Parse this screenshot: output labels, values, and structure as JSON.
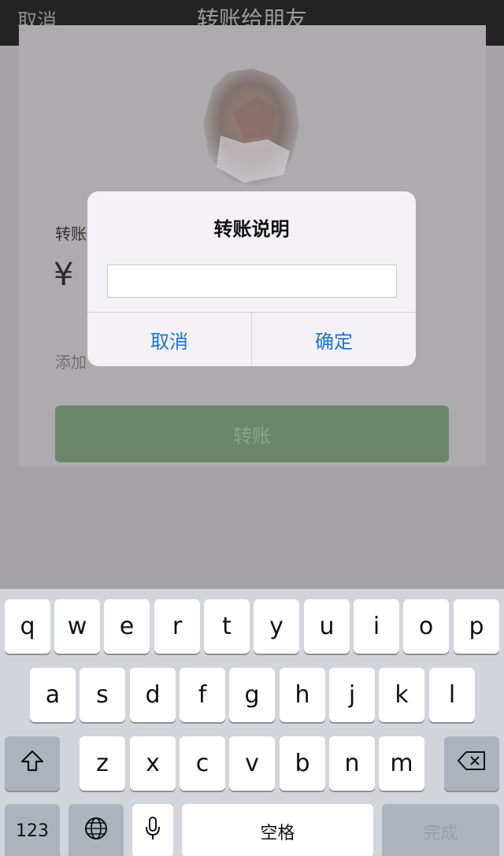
{
  "navbar": {
    "cancel_label": "取消",
    "title": "转账给朋友"
  },
  "page": {
    "amount_label": "转账",
    "currency_symbol": "¥",
    "add_note_label": "添加",
    "transfer_button": "转账"
  },
  "dialog": {
    "title": "转账说明",
    "input_value": "",
    "cancel_label": "取消",
    "confirm_label": "确定"
  },
  "keyboard": {
    "row1": [
      "q",
      "w",
      "e",
      "r",
      "t",
      "y",
      "u",
      "i",
      "o",
      "p"
    ],
    "row2": [
      "a",
      "s",
      "d",
      "f",
      "g",
      "h",
      "j",
      "k",
      "l"
    ],
    "row3": [
      "z",
      "x",
      "c",
      "v",
      "b",
      "n",
      "m"
    ],
    "numbers_label": "123",
    "space_label": "空格",
    "done_label": "完成",
    "icons": [
      "shift-icon",
      "backspace-icon",
      "globe-icon",
      "microphone-icon"
    ]
  },
  "colors": {
    "accent_blue": "#1a73d9",
    "transfer_green": "#6b876b",
    "navbar_bg": "#232323"
  }
}
